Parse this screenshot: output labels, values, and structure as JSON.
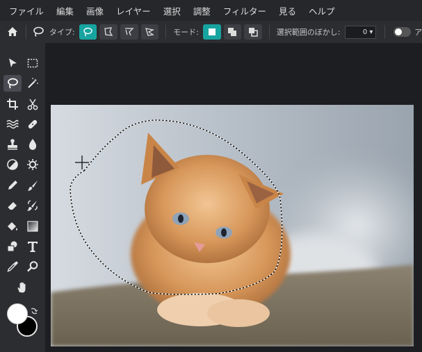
{
  "menu": [
    "ファイル",
    "編集",
    "画像",
    "レイヤー",
    "選択",
    "調整",
    "フィルター",
    "見る",
    "ヘルプ"
  ],
  "options": {
    "type_label": "タイプ:",
    "mode_label": "モード:",
    "feather_label": "選択範囲のぼかし:",
    "feather_value": "0 ▾",
    "truncated": "ア"
  },
  "tools": [
    "move-tool",
    "marquee-tool",
    "lasso-tool",
    "magic-wand-tool",
    "crop-tool",
    "scissors-tool",
    "liquify-tool",
    "healing-tool",
    "stamp-tool",
    "blur-tool",
    "dodge-tool",
    "sponge-tool",
    "pencil-tool",
    "brush-tool",
    "eraser-tool",
    "color-replace-tool",
    "bucket-tool",
    "gradient-tool",
    "shape-tool",
    "text-tool",
    "eyedropper-tool",
    "zoom-tool",
    "hand-tool"
  ],
  "colors": {
    "accent": "#17a4a0",
    "foreground": "#ffffff",
    "background": "#000000"
  }
}
